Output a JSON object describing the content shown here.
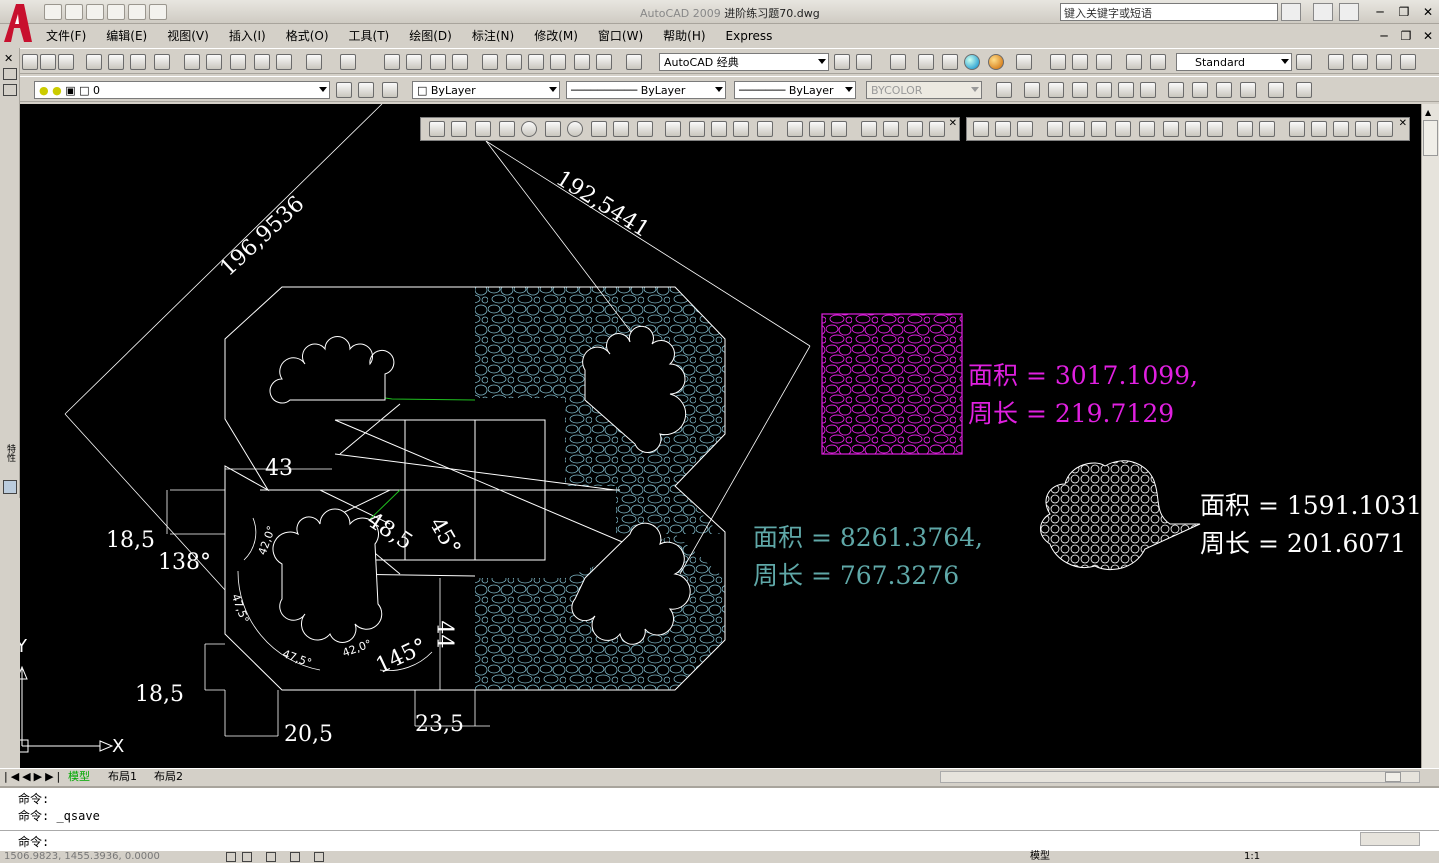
{
  "window": {
    "title_prefix": "AutoCAD 2009",
    "file_name": "进阶练习题70.dwg",
    "search_placeholder": "键入关键字或短语"
  },
  "menu": [
    "文件(F)",
    "编辑(E)",
    "视图(V)",
    "插入(I)",
    "格式(O)",
    "工具(T)",
    "绘图(D)",
    "标注(N)",
    "修改(M)",
    "窗口(W)",
    "帮助(H)",
    "Express"
  ],
  "toolbar": {
    "workspace": "AutoCAD 经典",
    "text_style": "Standard",
    "layer": "0",
    "color": "ByLayer",
    "linetype": "ByLayer",
    "lineweight": "ByLayer",
    "plotstyle": "BYCOLOR"
  },
  "drawing": {
    "dims": {
      "d1": "196,9536",
      "d2": "192,5441",
      "d3": "43",
      "d4": "18,5",
      "d5": "138°",
      "d6": "48,5",
      "d7": "45°",
      "d8": "42,0°",
      "d9": "47,5°",
      "d10": "47,5°",
      "d11": "42,0°",
      "d12": "145°",
      "d13": "44",
      "d14": "18,5",
      "d15": "20,5",
      "d16": "23,5"
    },
    "magenta_area": "面积 = 3017.1099,",
    "magenta_perimeter": "周长 = 219.7129",
    "cyan_area": "面积 = 8261.3764,",
    "cyan_perimeter": "周长 = 767.3276",
    "white_area": "面积 = 1591.1031",
    "white_perimeter": "周长 = 201.6071",
    "ucs_x": "X",
    "ucs_y": "Y"
  },
  "tabs": [
    "模型",
    "布局1",
    "布局2"
  ],
  "command": {
    "line1": "命令:",
    "line2": "命令: _qsave",
    "prompt": "命令:"
  },
  "status": {
    "coords": "1506.9823, 1455.3936, 0.0000",
    "model_label": "模型",
    "scale": "1:1"
  },
  "colors": {
    "magenta": "#e020e0",
    "cyan": "#5fa8a8",
    "hatch": "#7fb8c8",
    "green": "#20c020"
  }
}
